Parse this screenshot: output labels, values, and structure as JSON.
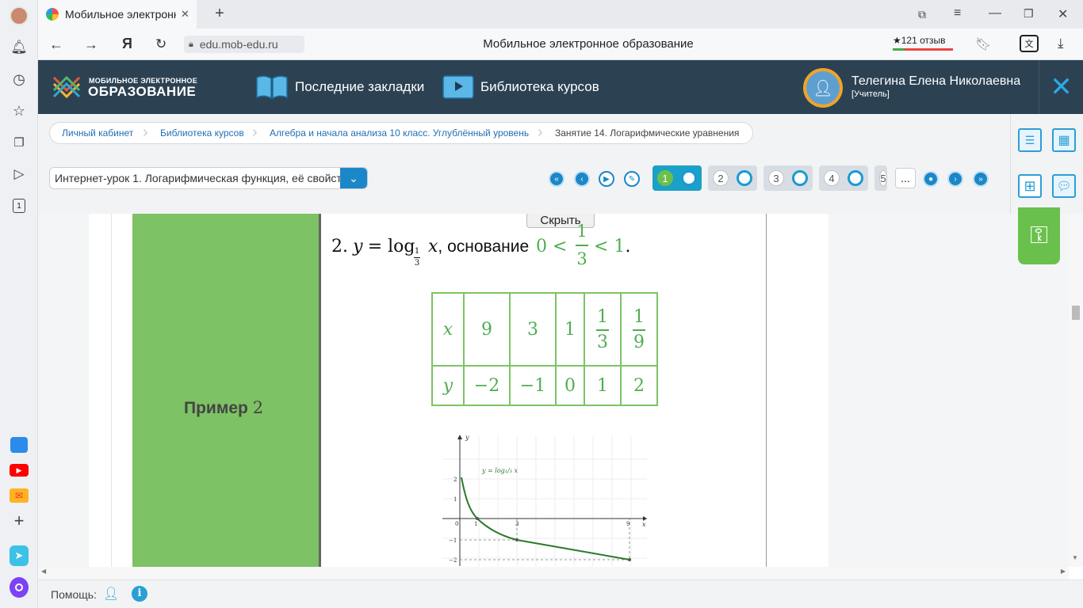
{
  "browser": {
    "tab_title": "Мобильное электронное образование",
    "url": "edu.mob-edu.ru",
    "page_title": "Мобильное электронное образование",
    "reviews": "★121 отзыв"
  },
  "header": {
    "logo_line1": "МОБИЛЬНОЕ ЭЛЕКТРОННОЕ",
    "logo_line2": "ОБРАЗОВАНИЕ",
    "bookmarks": "Последние закладки",
    "library": "Библиотека курсов",
    "user_name": "Телегина Елена Николаевна",
    "user_role": "[Учитель]"
  },
  "breadcrumbs": [
    "Личный кабинет",
    "Библиотека курсов",
    "Алгебра и начала анализа 10 класс. Углублённый уровень",
    "Занятие 14. Логарифмические уравнения"
  ],
  "lesson_select": "Интернет-урок 1. Логарифмическая функция, её свойст",
  "pager": {
    "pages": [
      "1",
      "2",
      "3",
      "4",
      "5"
    ],
    "ellipsis": "..."
  },
  "content": {
    "hide_button": "Скрыть",
    "example_label": "Пример",
    "example_number": "2",
    "formula_num": "2.",
    "formula_base_num": "1",
    "formula_base_den": "3",
    "formula_text": ", основание",
    "table": {
      "x_label": "x",
      "y_label": "y",
      "x_values": [
        "9",
        "3",
        "1",
        "1/3",
        "1/9"
      ],
      "y_values": [
        "−2",
        "−1",
        "0",
        "1",
        "2"
      ]
    },
    "graph_label": "y = log₁/₃ x",
    "graph_ticks": [
      "0",
      "1",
      "3",
      "9",
      "1",
      "−1",
      "−2",
      "2"
    ]
  },
  "bottom": {
    "help": "Помощь:"
  }
}
